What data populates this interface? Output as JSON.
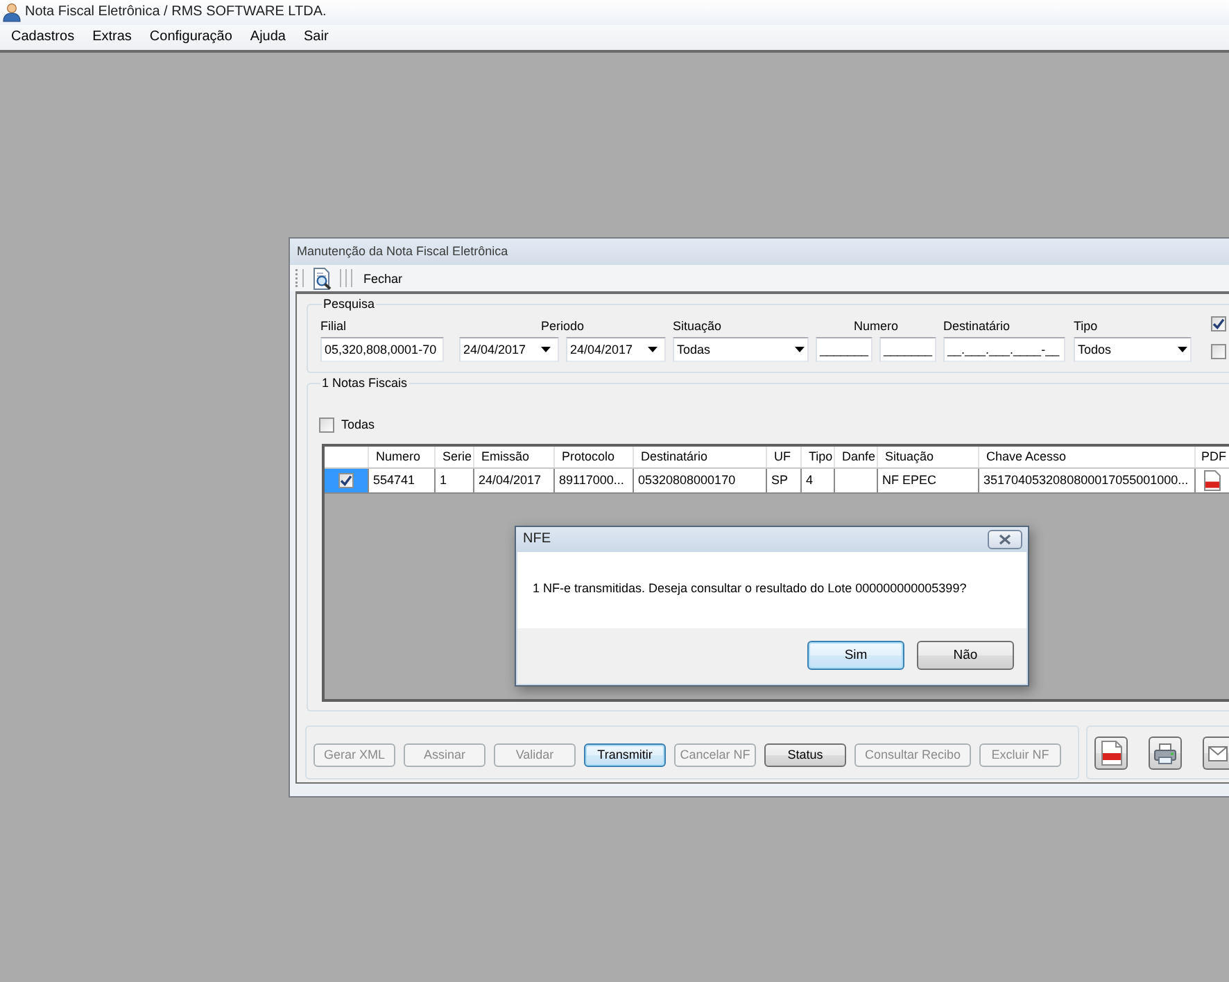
{
  "app_window": {
    "title": "Nota Fiscal Eletrônica / RMS SOFTWARE LTDA."
  },
  "menu": [
    "Cadastros",
    "Extras",
    "Configuração",
    "Ajuda",
    "Sair"
  ],
  "child_window": {
    "title": "Manutenção da Nota Fiscal Eletrônica",
    "toolbar_button": "Fechar",
    "search": {
      "title": "Pesquisa",
      "fields": [
        {
          "kind": "text",
          "label": "Filial",
          "values": [
            "05,320,808,0001-70"
          ]
        },
        {
          "kind": "date",
          "label": "Periodo",
          "values": [
            "24/04/2017",
            "24/04/2017"
          ]
        },
        {
          "kind": "combo",
          "label": "Situação",
          "values": [
            "Todas"
          ]
        },
        {
          "kind": "text",
          "label": "Numero",
          "values": [
            "_______",
            "_______"
          ]
        },
        {
          "kind": "text",
          "label": "Destinatário",
          "values": [
            "__.___.___.____-__"
          ]
        },
        {
          "kind": "combo",
          "label": "Tipo",
          "values": [
            "Todos"
          ]
        }
      ],
      "options": [
        {
          "checked": true
        },
        {
          "checked": false
        }
      ]
    },
    "list": {
      "title": "1 Notas Fiscais",
      "select_all": {
        "label": "Todas",
        "checked": false
      },
      "columns": [
        "Numero",
        "Serie",
        "Emissão",
        "Protocolo",
        "Destinatário",
        "UF",
        "Tipo",
        "Danfe",
        "Situação",
        "Chave Acesso",
        "PDF"
      ],
      "rows": [
        {
          "checked": true,
          "selected": true,
          "pdf": true,
          "cells": [
            "554741",
            "1",
            "24/04/2017",
            "89117000...",
            "05320808000170",
            "SP",
            "4",
            null,
            "NF EPEC",
            "3517040532080800017055001000..."
          ]
        }
      ]
    },
    "actions": [
      {
        "label": "Gerar XML",
        "disabled": true,
        "focused": false
      },
      {
        "label": "Assinar",
        "disabled": true,
        "focused": false
      },
      {
        "label": "Validar",
        "disabled": true,
        "focused": false
      },
      {
        "label": "Transmitir",
        "disabled": false,
        "focused": true
      },
      {
        "label": "Cancelar NF",
        "disabled": true,
        "focused": false
      },
      {
        "label": "Status",
        "disabled": false,
        "focused": false
      },
      {
        "label": "Consultar Recibo",
        "disabled": true,
        "focused": false
      },
      {
        "label": "Excluir NF",
        "disabled": true,
        "focused": false
      }
    ]
  },
  "dialog": {
    "title": "NFE",
    "message": "1 NF-e transmitidas. Deseja consultar o resultado do Lote 000000000005399?",
    "buttons": [
      {
        "label": "Sim",
        "default": true
      },
      {
        "label": "Não",
        "default": false
      }
    ]
  }
}
